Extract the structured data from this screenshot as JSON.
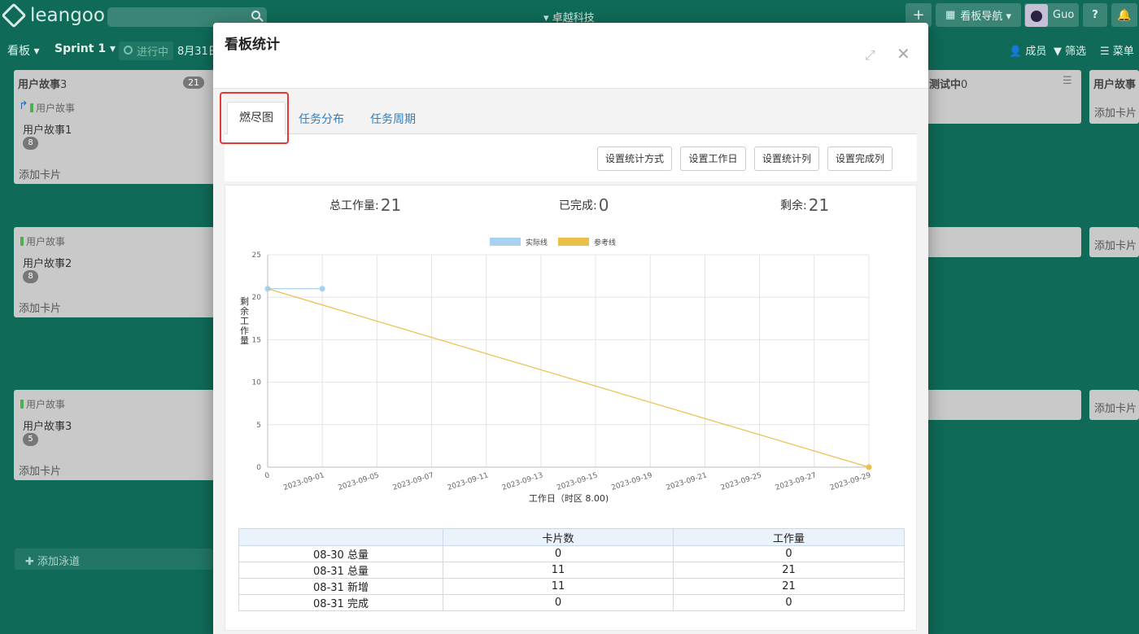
{
  "app": {
    "brand": "leangoo",
    "company": "▾ 卓越科技",
    "user": "Guo"
  },
  "topbar": {
    "add_label": "+",
    "nav_label": "看板导航 ▾",
    "help_label": "?",
    "bell_label": "🔔"
  },
  "subbar": {
    "board_label": "看板 ▾",
    "sprint_label": "Sprint 1 ▾",
    "status_label": "进行中",
    "date_label": "8月31日",
    "members_label": "成员",
    "filter_label": "筛选",
    "menu_label": "菜单"
  },
  "board": {
    "column_title": "用户故事",
    "column_count": "3",
    "column_badge": "21",
    "testing_title": "测试中",
    "testing_count": "0",
    "right_column_title": "用户故事",
    "add_card_label": "添加卡片",
    "add_lane_label": "添加泳道",
    "cards": [
      {
        "type": "用户故事",
        "title": "用户故事1",
        "points": "8"
      },
      {
        "type": "用户故事",
        "title": "用户故事2",
        "points": "8"
      },
      {
        "type": "用户故事",
        "title": "用户故事3",
        "points": "5"
      }
    ]
  },
  "modal": {
    "title": "看板统计",
    "tabs": [
      "燃尽图",
      "任务分布",
      "任务周期"
    ],
    "buttons": [
      "设置统计方式",
      "设置工作日",
      "设置统计列",
      "设置完成列"
    ],
    "summary": {
      "total_label": "总工作量:",
      "total_value": "21",
      "done_label": "已完成:",
      "done_value": "0",
      "remain_label": "剩余:",
      "remain_value": "21"
    },
    "table": {
      "headers": [
        "",
        "卡片数",
        "工作量"
      ],
      "rows": [
        [
          "08-30 总量",
          "0",
          "0"
        ],
        [
          "08-31 总量",
          "11",
          "21"
        ],
        [
          "08-31 新增",
          "11",
          "21"
        ],
        [
          "08-31 完成",
          "0",
          "0"
        ]
      ]
    }
  },
  "chart_data": {
    "type": "line",
    "title": "",
    "xlabel": "工作日（时区 8.00)",
    "ylabel": "剩余工作量",
    "ylim": [
      0,
      25
    ],
    "yticks": [
      0,
      5,
      10,
      15,
      20,
      25
    ],
    "x_ticks": [
      "0",
      "2023-09-01",
      "2023-09-05",
      "2023-09-07",
      "2023-09-11",
      "2023-09-13",
      "2023-09-15",
      "2023-09-19",
      "2023-09-21",
      "2023-09-25",
      "2023-09-27",
      "2023-09-29"
    ],
    "legend": "top-center",
    "grid": true,
    "series": [
      {
        "name": "实际线",
        "color": "#a9d1f0",
        "points": [
          [
            "0",
            21
          ],
          [
            "2023-08-31",
            21
          ],
          [
            "2023-09-01",
            21
          ]
        ]
      },
      {
        "name": "参考线",
        "color": "#e8c04a",
        "points": [
          [
            "0",
            21
          ],
          [
            "2023-09-29",
            0
          ]
        ]
      }
    ]
  }
}
